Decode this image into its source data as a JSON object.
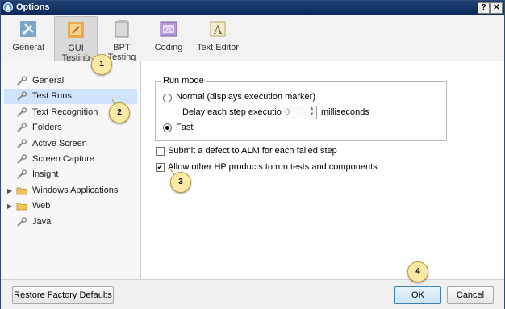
{
  "window": {
    "title": "Options",
    "help_button": "?",
    "close_button": "✕"
  },
  "toolbar": [
    {
      "id": "general",
      "label": "General",
      "icon": "wrench-screwdriver-icon"
    },
    {
      "id": "gui",
      "label": "GUI Testing",
      "icon": "gui-testing-icon"
    },
    {
      "id": "bpt",
      "label": "BPT Testing",
      "icon": "bpt-testing-icon"
    },
    {
      "id": "coding",
      "label": "Coding",
      "icon": "coding-icon"
    },
    {
      "id": "text_editor",
      "label": "Text Editor",
      "icon": "text-editor-icon"
    }
  ],
  "toolbar_labels": {
    "general": "General",
    "gui_line1": "GUI",
    "gui_line2": "Testing",
    "bpt_line1": "BPT",
    "bpt_line2": "Testing",
    "coding": "Coding",
    "text_editor": "Text Editor"
  },
  "sidebar": {
    "items": [
      {
        "label": "General",
        "icon": "wrench-icon"
      },
      {
        "label": "Test Runs",
        "icon": "wrench-icon",
        "selected": true
      },
      {
        "label": "Text Recognition",
        "icon": "wrench-icon"
      },
      {
        "label": "Folders",
        "icon": "wrench-icon"
      },
      {
        "label": "Active Screen",
        "icon": "wrench-icon"
      },
      {
        "label": "Screen Capture",
        "icon": "wrench-icon"
      },
      {
        "label": "Insight",
        "icon": "wrench-icon"
      },
      {
        "label": "Windows Applications",
        "icon": "folder-icon",
        "expandable": true
      },
      {
        "label": "Web",
        "icon": "folder-icon",
        "expandable": true
      },
      {
        "label": "Java",
        "icon": "wrench-icon"
      }
    ]
  },
  "run_mode": {
    "legend": "Run mode",
    "normal_label": "Normal (displays execution marker)",
    "delay_label": "Delay each step execution by:",
    "delay_value": "0",
    "delay_unit": "milliseconds",
    "fast_label": "Fast",
    "selected": "Fast"
  },
  "options": {
    "submit_defect_label": "Submit a defect to ALM for each failed step",
    "submit_defect_checked": false,
    "allow_hp_label": "Allow other HP products to run tests and components",
    "allow_hp_checked": true,
    "check_mark": "✔"
  },
  "footer": {
    "restore_label": "Restore Factory Defaults",
    "ok_label": "OK",
    "cancel_label": "Cancel"
  },
  "callouts": [
    "1",
    "2",
    "3",
    "4"
  ],
  "colors": {
    "titlebar": "#0b2a5a",
    "selection": "#cfe4fb",
    "callout_fill": "#fbe9a5",
    "default_button": "#cbe4f7"
  }
}
